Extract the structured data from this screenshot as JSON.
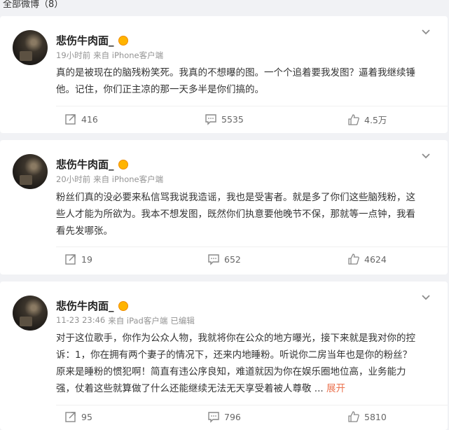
{
  "header": {
    "title": "全部微博（8）"
  },
  "posts": [
    {
      "name": "悲伤牛肉面_",
      "time": "19小时前",
      "source": "来自 iPhone客户端",
      "edited": "",
      "lines": [
        "真的是被现在的脑残粉笑死。我真的不想曝的图。一个个追着要我发图？逼着我继续锤",
        "他。记住，你们正主凉的那一天多半是你们搞的。"
      ],
      "expand_label": "",
      "reposts": "416",
      "comments": "5535",
      "likes": "4.5万"
    },
    {
      "name": "悲伤牛肉面_",
      "time": "20小时前",
      "source": "来自 iPhone客户端",
      "edited": "",
      "lines": [
        "粉丝们真的没必要来私信骂我说我造谣，我也是受害者。就是多了你们这些脑残粉，这",
        "些人才能为所欲为。我本不想发图，既然你们执意要他晚节不保，那就等一点钟，我看",
        "看先发哪张。"
      ],
      "expand_label": "",
      "reposts": "19",
      "comments": "652",
      "likes": "4624"
    },
    {
      "name": "悲伤牛肉面_",
      "time": "11-23 23:46",
      "source": "来自 iPad客户端",
      "edited": "已编辑",
      "lines": [
        "对于这位歌手，你作为公众人物，我就将你在公众的地方曝光，接下来就是我对你的控",
        "诉：1，你在拥有两个妻子的情况下，还来内地睡粉。听说你二房当年也是你的粉丝？",
        "原来是睡粉的惯犯啊！简直有违公序良知，难道就因为你在娱乐圈地位高，业务能力",
        "强，仗着这些就算做了什么还能继续无法无天享受着被人尊敬 ..."
      ],
      "expand_label": "展开",
      "reposts": "95",
      "comments": "796",
      "likes": "5810"
    }
  ],
  "icons": {
    "repost": "repost-icon",
    "comment": "comment-icon",
    "like": "like-icon",
    "menu": "chevron-down-icon"
  },
  "colors": {
    "expand": "#eb7350",
    "meta": "#939393",
    "vip": "#ffb400"
  }
}
